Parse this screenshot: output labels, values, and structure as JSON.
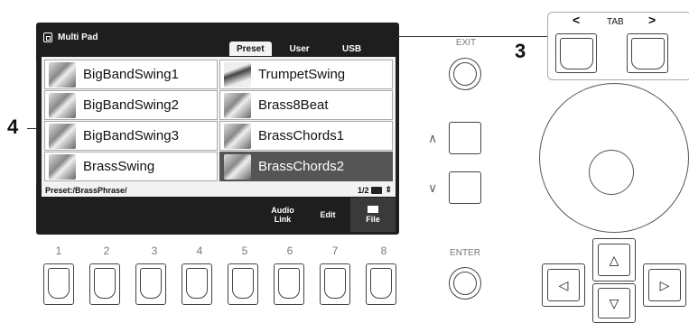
{
  "screen": {
    "title": "Multi Pad",
    "tabs": [
      "Preset",
      "User",
      "USB"
    ],
    "active_tab": "Preset",
    "items": [
      {
        "label": "BigBandSwing1",
        "icon": "brass-icon"
      },
      {
        "label": "TrumpetSwing",
        "icon": "trumpet-icon"
      },
      {
        "label": "BigBandSwing2",
        "icon": "brass-icon"
      },
      {
        "label": "Brass8Beat",
        "icon": "brass-icon"
      },
      {
        "label": "BigBandSwing3",
        "icon": "brass-icon"
      },
      {
        "label": "BrassChords1",
        "icon": "brass-icon"
      },
      {
        "label": "BrassSwing",
        "icon": "brass-icon"
      },
      {
        "label": "BrassChords2",
        "icon": "brass-icon"
      }
    ],
    "selected_item": "BrassChords2",
    "path": "Preset:/BrassPhrase/",
    "page": "1/2",
    "softkeys": {
      "audio_link_line1": "Audio",
      "audio_link_line2": "Link",
      "edit": "Edit",
      "file": "File"
    }
  },
  "panel": {
    "exit_label": "EXIT",
    "enter_label": "ENTER",
    "tab_label": "TAB",
    "tab_left": "<",
    "tab_right": ">",
    "up_glyph": "∧",
    "down_glyph": "∨",
    "cursor_up": "△",
    "cursor_down": "▽",
    "cursor_left": "◁",
    "cursor_right": "▷",
    "pad_numbers": [
      "1",
      "2",
      "3",
      "4",
      "5",
      "6",
      "7",
      "8"
    ]
  },
  "callouts": {
    "tab_callout": "3",
    "list_callout": "4"
  }
}
